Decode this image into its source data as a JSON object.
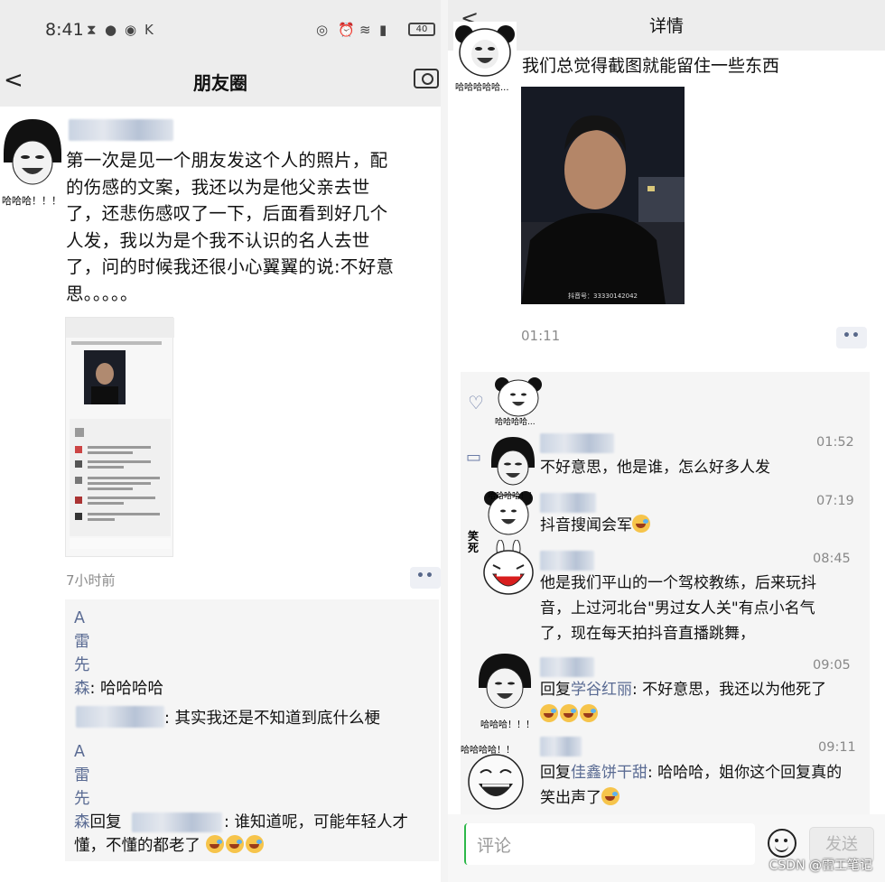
{
  "left": {
    "status": {
      "time": "8:41",
      "battery": "40"
    },
    "nav": {
      "back": "<",
      "title": "朋友圈"
    },
    "avatar_caption": "哈哈哈！！！",
    "post_lines": [
      "第一次是见一个朋友发这个人的照片，配",
      "的伤感的文案，我还以为是他父亲去世",
      "了，还悲伤感叹了一下，后面看到好几个",
      "人发，我以为是个我不认识的名人去世",
      "了，问的时候我还很小心翼翼的说:不好意",
      "思。。。。。"
    ],
    "post_time": "7小时前",
    "more": "••",
    "comments": {
      "c1_name_lines": [
        "A",
        "雷",
        "先",
        "森"
      ],
      "c1_text": ": 哈哈哈哈",
      "c2_text": ": 其实我还是不知道到底什么梗",
      "c3_name_lines": [
        "A",
        "雷",
        "先",
        "森"
      ],
      "c3_reply": "回复",
      "c3_text_1": ": 谁知道呢，可能年轻人才",
      "c3_text_2": "懂，不懂的都老了"
    }
  },
  "right": {
    "header": {
      "back": "<",
      "title": "详情"
    },
    "avatar_caption": "哈哈哈哈哈...",
    "post_text": "我们总觉得截图就能留住一些东西",
    "photo_caption": "抖音号：33330142042",
    "post_time": "01:11",
    "more": "••",
    "like_caption": "哈哈哈哈...",
    "comments": [
      {
        "time": "01:52",
        "lines": [
          "不好意思，他是谁，怎么好多人发"
        ]
      },
      {
        "time": "07:19",
        "lines": [
          "抖音搜闻会军"
        ],
        "emoji": 1
      },
      {
        "time": "08:45",
        "lines": [
          "他是我们平山的一个驾校教练，后来玩抖",
          "音，上过河北台\"男过女人关\"有点小名气",
          "了，现在每天拍抖音直播跳舞，"
        ]
      },
      {
        "time": "09:05",
        "reply": "回复",
        "reply_to": "学谷红丽",
        "text": ": 不好意思，我还以为他死了"
      },
      {
        "time": "09:11",
        "reply": "回复",
        "reply_to": "佳鑫饼干甜",
        "text": ": 哈哈哈，姐你这个回复真的",
        "text2": "笑出声了"
      }
    ],
    "avatar_captions": [
      "哈哈哈哈...",
      "哈哈哈！！！",
      "哈哈哈哈！！",
      "笑死"
    ],
    "input_placeholder": "评论",
    "send_label": "发送",
    "watermark": "CSDN @雷工笔记"
  }
}
